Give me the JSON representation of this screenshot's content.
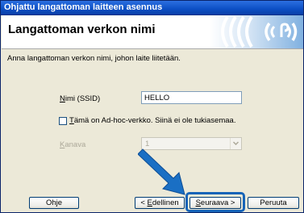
{
  "window": {
    "title": "Ohjattu langattoman laitteen asennus"
  },
  "header": {
    "title": "Langattoman verkon nimi",
    "logo_icon": "wifi-signal-logo"
  },
  "main": {
    "instruction": "Anna langattoman verkon nimi, johon laite liitetään.",
    "ssid": {
      "label_mnemonic": "N",
      "label_rest": "imi (SSID)",
      "value": "HELLO"
    },
    "adhoc": {
      "checked": false,
      "label_mnemonic": "T",
      "label_rest": "ämä on Ad-hoc-verkko. Siinä ei ole tukiasemaa."
    },
    "channel": {
      "label_mnemonic": "K",
      "label_rest": "anava",
      "value": "1",
      "disabled": true
    }
  },
  "buttons": {
    "help_pre": "Oh",
    "help_mnemonic": "j",
    "help_post": "e",
    "back_pre": "< ",
    "back_mnemonic": "E",
    "back_post": "dellinen",
    "next_mnemonic": "S",
    "next_post": "euraava >",
    "cancel_label": "Peruuta"
  },
  "colors": {
    "titlebar": "#0c4fc4",
    "highlight": "#1664b8",
    "arrow": "#1a6fc4",
    "window_bg": "#ece9d8"
  }
}
